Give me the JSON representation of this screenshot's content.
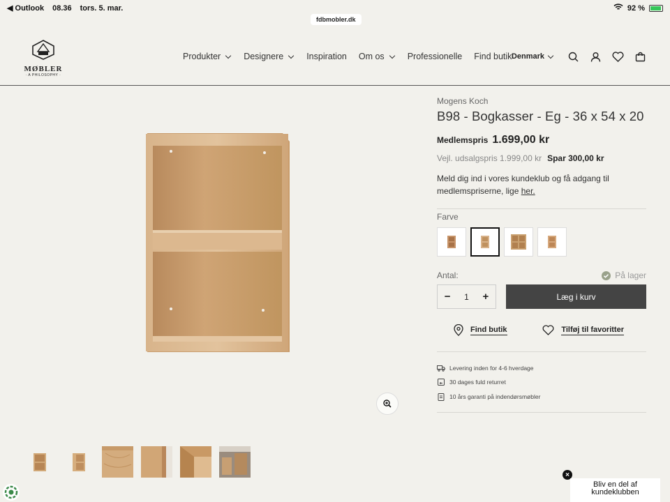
{
  "status_bar": {
    "back_app": "◀ Outlook",
    "time": "08.36",
    "date": "tors. 5. mar.",
    "battery": "92 %",
    "battery_level": 0.92
  },
  "browser": {
    "url": "fdbmobler.dk"
  },
  "logo": {
    "brand": "MØBLER",
    "tagline": "· A PHILOSOPHY ·"
  },
  "nav": {
    "items": [
      {
        "label": "Produkter",
        "dropdown": true
      },
      {
        "label": "Designere",
        "dropdown": true
      },
      {
        "label": "Inspiration",
        "dropdown": false
      },
      {
        "label": "Om os",
        "dropdown": true
      },
      {
        "label": "Professionelle",
        "dropdown": false
      },
      {
        "label": "Find butik",
        "dropdown": false
      }
    ],
    "country": "Denmark",
    "icons": [
      "search-icon",
      "account-icon",
      "heart-icon",
      "cart-icon"
    ]
  },
  "product": {
    "designer": "Mogens Koch",
    "title": "B98 - Bogkasser - Eg - 36 x 54 x 20",
    "member_price_label": "Medlemspris",
    "member_price": "1.699,00 kr",
    "rrp": "Vejl. udsalgspris 1.999,00 kr",
    "saving": "Spar 300,00 kr",
    "club_text": "Meld dig ind i vores kundeklub og få adgang til medlemspriserne, lige ",
    "club_link": "her.",
    "color_label": "Farve",
    "selected_swatch": 2,
    "quantity_label": "Antal:",
    "stock": "På lager",
    "quantity": "1",
    "add_to_cart": "Læg i kurv",
    "find_store": "Find butik",
    "add_favorite": "Tilføj til favoritter",
    "features": [
      {
        "icon": "truck-icon",
        "text": "Levering inden for 4-6 hverdage"
      },
      {
        "icon": "return-icon",
        "text": "30 dages fuld returret"
      },
      {
        "icon": "warranty-icon",
        "text": "10 års garanti på indendørsmøbler"
      }
    ]
  },
  "gallery": {
    "active_thumb": 1,
    "thumb_count": 6
  },
  "popup": {
    "line1": "Bliv en del af",
    "line2": "kundeklubben"
  },
  "colors": {
    "accent": "#444444",
    "wood": "#d6b38c",
    "wood_dark": "#b8875c",
    "stock_green": "#9aa28b"
  }
}
